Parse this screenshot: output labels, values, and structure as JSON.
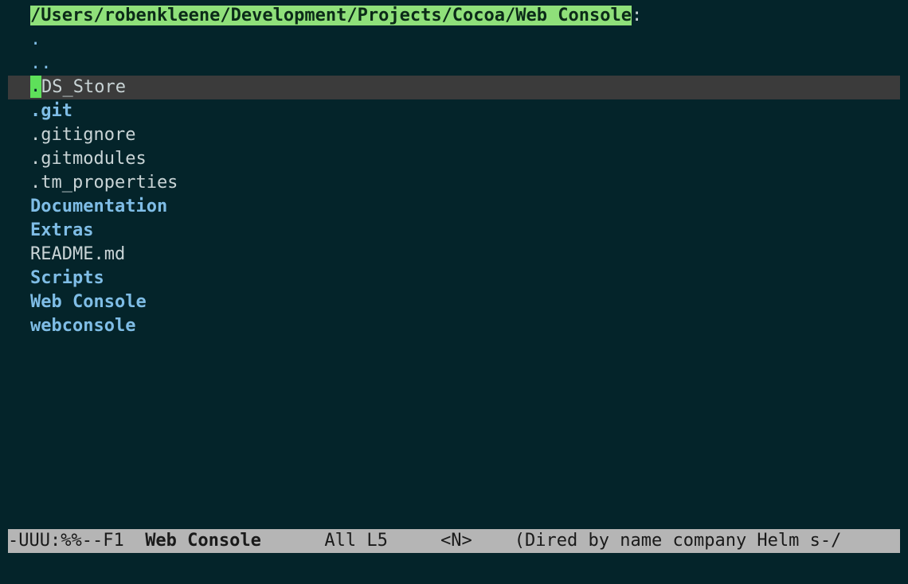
{
  "header": {
    "path": "/Users/robenkleene/Development/Projects/Cocoa/Web Console",
    "suffix": ":"
  },
  "entries": [
    {
      "name": ".",
      "kind": "dir-dot"
    },
    {
      "name": "..",
      "kind": "dir-dot"
    },
    {
      "cursor_char": ".",
      "name": "DS_Store",
      "kind": "file",
      "current": true
    },
    {
      "name": ".git",
      "kind": "dir"
    },
    {
      "name": ".gitignore",
      "kind": "file"
    },
    {
      "name": ".gitmodules",
      "kind": "file"
    },
    {
      "name": ".tm_properties",
      "kind": "file"
    },
    {
      "name": "Documentation",
      "kind": "dir"
    },
    {
      "name": "Extras",
      "kind": "dir"
    },
    {
      "name": "README.md",
      "kind": "file"
    },
    {
      "name": "Scripts",
      "kind": "dir"
    },
    {
      "name": "Web Console",
      "kind": "dir"
    },
    {
      "name": "webconsole",
      "kind": "dir"
    }
  ],
  "modeline": {
    "status": "-UUU:%%--F1  ",
    "buffer_name": "Web Console",
    "position": "      All L5     ",
    "state": "<N>",
    "modes": "    (Dired by name company Helm s-/"
  }
}
